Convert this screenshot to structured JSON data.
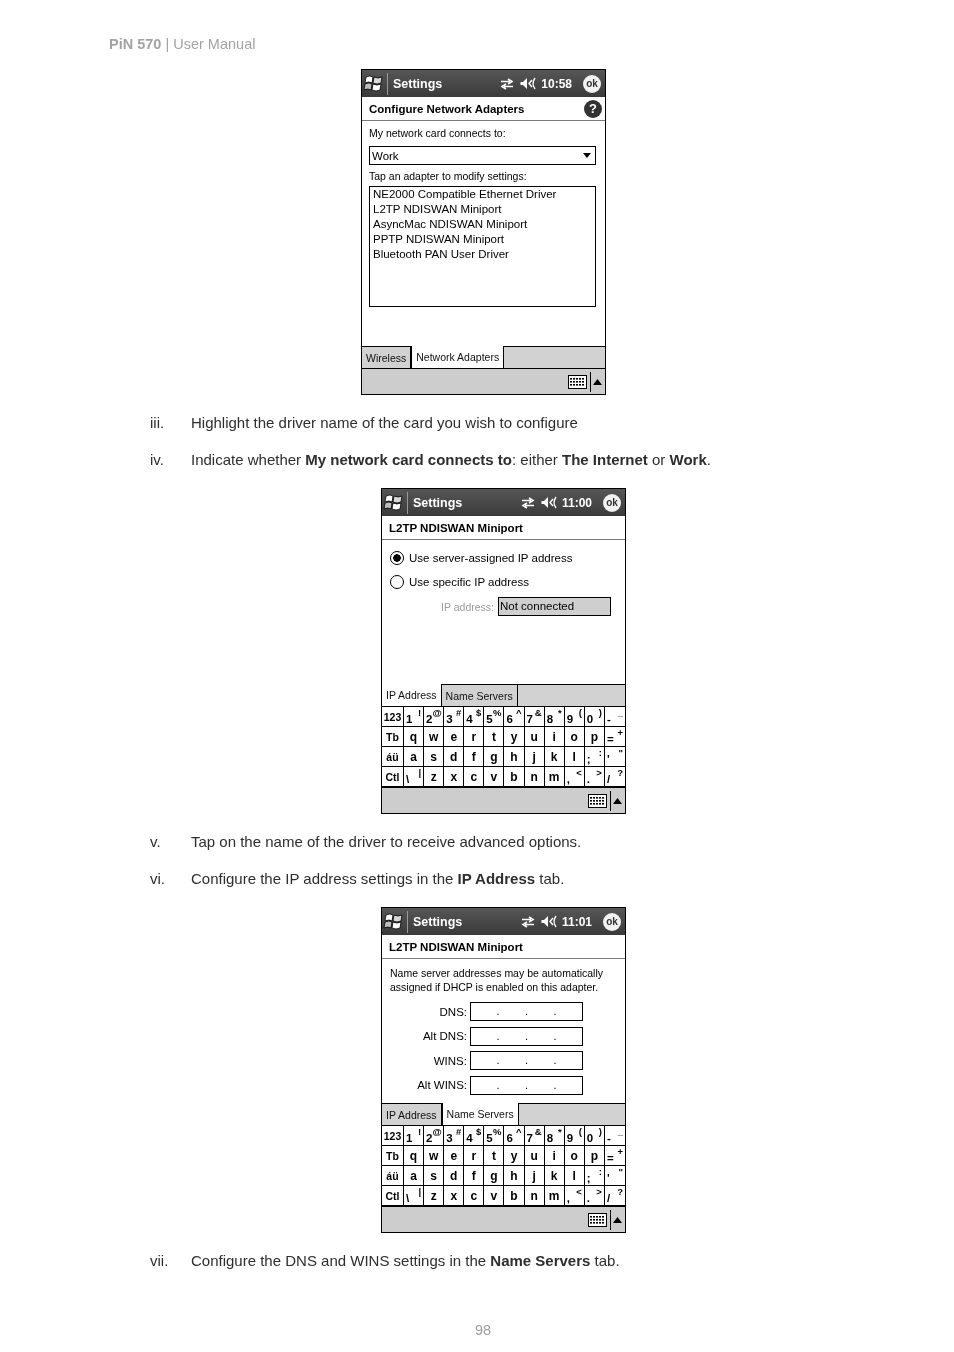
{
  "header": "**PiN 570** | User Manual",
  "content": [
    {
      "kind": "screen",
      "title_bar": {
        "title": "Settings",
        "time": "10:58",
        "ok": "ok"
      },
      "heading": {
        "title": "Configure Network Adapters",
        "help": "?"
      },
      "body": [
        {
          "kind": "label",
          "text": "My network card connects to:"
        },
        {
          "kind": "dropdown",
          "value": "Work"
        },
        {
          "kind": "label",
          "text": "Tap an adapter to modify settings:"
        },
        {
          "kind": "list",
          "items": [
            {
              "label": "NE2000 Compatible Ethernet Driver",
              "selected": false
            },
            {
              "label": "L2TP NDISWAN Miniport",
              "selected": false
            },
            {
              "label": "AsyncMac NDISWAN Miniport",
              "selected": false
            },
            {
              "label": "PPTP NDISWAN Miniport",
              "selected": false
            },
            {
              "label": "Bluetooth PAN User Driver",
              "selected": false
            }
          ]
        }
      ],
      "tabs": [
        {
          "label": "Wireless",
          "selected": false
        },
        {
          "label": "Network Adapters",
          "selected": true
        }
      ]
    },
    {
      "kind": "step",
      "numeral": "iii.",
      "text": "Highlight the driver name of the card you wish to configure"
    },
    {
      "kind": "step",
      "numeral": "iv.",
      "text": "Indicate whether **My network card connects to**: either **The Internet** or **Work**."
    },
    {
      "kind": "screen",
      "title_bar": {
        "title": "Settings",
        "time": "11:00",
        "ok": "ok"
      },
      "heading": {
        "title": "L2TP NDISWAN Miniport"
      },
      "body": [
        {
          "kind": "radio",
          "label": "Use server-assigned IP address",
          "selected": true
        },
        {
          "kind": "radio",
          "label": "Use specific IP address",
          "selected": false
        },
        {
          "kind": "ip_field",
          "label": "IP address:",
          "value": "Not connected",
          "disabled": true
        }
      ],
      "tabs": [
        {
          "label": "IP Address",
          "selected": true
        },
        {
          "label": "Name Servers",
          "selected": false
        }
      ],
      "keyboard": [
        [
          {
            "kind": "function",
            "label": "123"
          },
          {
            "kind": "dual",
            "label": "1",
            "shift": "!"
          },
          {
            "kind": "dual",
            "label": "2",
            "shift": "@"
          },
          {
            "kind": "dual",
            "label": "3",
            "shift": "#"
          },
          {
            "kind": "dual",
            "label": "4",
            "shift": "$"
          },
          {
            "kind": "dual",
            "label": "5",
            "shift": "%"
          },
          {
            "kind": "dual",
            "label": "6",
            "shift": "^"
          },
          {
            "kind": "dual",
            "label": "7",
            "shift": "&"
          },
          {
            "kind": "dual",
            "label": "8",
            "shift": "*"
          },
          {
            "kind": "dual",
            "label": "9",
            "shift": "("
          },
          {
            "kind": "dual",
            "label": "0",
            "shift": ")"
          },
          {
            "kind": "dual",
            "label": "-",
            "shift": "_"
          }
        ],
        [
          {
            "kind": "function",
            "label": "Tb"
          },
          {
            "kind": "letter",
            "label": "q"
          },
          {
            "kind": "letter",
            "label": "w"
          },
          {
            "kind": "letter",
            "label": "e"
          },
          {
            "kind": "letter",
            "label": "r"
          },
          {
            "kind": "letter",
            "label": "t"
          },
          {
            "kind": "letter",
            "label": "y"
          },
          {
            "kind": "letter",
            "label": "u"
          },
          {
            "kind": "letter",
            "label": "i"
          },
          {
            "kind": "letter",
            "label": "o"
          },
          {
            "kind": "letter",
            "label": "p"
          },
          {
            "kind": "dual",
            "label": "=",
            "shift": "+"
          }
        ],
        [
          {
            "kind": "function",
            "label": "áü"
          },
          {
            "kind": "letter",
            "label": "a"
          },
          {
            "kind": "letter",
            "label": "s"
          },
          {
            "kind": "letter",
            "label": "d"
          },
          {
            "kind": "letter",
            "label": "f"
          },
          {
            "kind": "letter",
            "label": "g"
          },
          {
            "kind": "letter",
            "label": "h"
          },
          {
            "kind": "letter",
            "label": "j"
          },
          {
            "kind": "letter",
            "label": "k"
          },
          {
            "kind": "letter",
            "label": "l"
          },
          {
            "kind": "dual",
            "label": ";",
            "shift": ":"
          },
          {
            "kind": "dual",
            "label": "'",
            "shift": "\""
          }
        ],
        [
          {
            "kind": "function",
            "label": "Ctl"
          },
          {
            "kind": "dual",
            "label": "\\",
            "shift": "|"
          },
          {
            "kind": "letter",
            "label": "z"
          },
          {
            "kind": "letter",
            "label": "x"
          },
          {
            "kind": "letter",
            "label": "c"
          },
          {
            "kind": "letter",
            "label": "v"
          },
          {
            "kind": "letter",
            "label": "b"
          },
          {
            "kind": "letter",
            "label": "n"
          },
          {
            "kind": "letter",
            "label": "m"
          },
          {
            "kind": "dual",
            "label": ",",
            "shift": "<"
          },
          {
            "kind": "dual",
            "label": ".",
            "shift": ">"
          },
          {
            "kind": "dual",
            "label": "/",
            "shift": "?"
          }
        ]
      ]
    },
    {
      "kind": "step",
      "numeral": "v.",
      "text": "Tap on the name of the driver to receive advanced options."
    },
    {
      "kind": "step",
      "numeral": "vi.",
      "text": "Configure the IP address settings in the **IP Address** tab."
    },
    {
      "kind": "screen",
      "title_bar": {
        "title": "Settings",
        "time": "11:01",
        "ok": "ok"
      },
      "heading": {
        "title": "L2TP NDISWAN Miniport"
      },
      "body": [
        {
          "kind": "paragraph",
          "text": "Name server addresses may be automatically assigned if DHCP is enabled on this adapter."
        },
        {
          "kind": "address_field",
          "label": "DNS:",
          "separators": [
            ".",
            ".",
            "."
          ]
        },
        {
          "kind": "address_field",
          "label": "Alt DNS:",
          "separators": [
            ".",
            ".",
            "."
          ]
        },
        {
          "kind": "address_field",
          "label": "WINS:",
          "separators": [
            ".",
            ".",
            "."
          ]
        },
        {
          "kind": "address_field",
          "label": "Alt WINS:",
          "separators": [
            ".",
            ".",
            "."
          ]
        }
      ],
      "tabs": [
        {
          "label": "IP Address",
          "selected": false
        },
        {
          "label": "Name Servers",
          "selected": true
        }
      ],
      "keyboard": [
        [
          {
            "kind": "function",
            "label": "123"
          },
          {
            "kind": "dual",
            "label": "1",
            "shift": "!"
          },
          {
            "kind": "dual",
            "label": "2",
            "shift": "@"
          },
          {
            "kind": "dual",
            "label": "3",
            "shift": "#"
          },
          {
            "kind": "dual",
            "label": "4",
            "shift": "$"
          },
          {
            "kind": "dual",
            "label": "5",
            "shift": "%"
          },
          {
            "kind": "dual",
            "label": "6",
            "shift": "^"
          },
          {
            "kind": "dual",
            "label": "7",
            "shift": "&"
          },
          {
            "kind": "dual",
            "label": "8",
            "shift": "*"
          },
          {
            "kind": "dual",
            "label": "9",
            "shift": "("
          },
          {
            "kind": "dual",
            "label": "0",
            "shift": ")"
          },
          {
            "kind": "dual",
            "label": "-",
            "shift": "_"
          }
        ],
        [
          {
            "kind": "function",
            "label": "Tb"
          },
          {
            "kind": "letter",
            "label": "q"
          },
          {
            "kind": "letter",
            "label": "w"
          },
          {
            "kind": "letter",
            "label": "e"
          },
          {
            "kind": "letter",
            "label": "r"
          },
          {
            "kind": "letter",
            "label": "t"
          },
          {
            "kind": "letter",
            "label": "y"
          },
          {
            "kind": "letter",
            "label": "u"
          },
          {
            "kind": "letter",
            "label": "i"
          },
          {
            "kind": "letter",
            "label": "o"
          },
          {
            "kind": "letter",
            "label": "p"
          },
          {
            "kind": "dual",
            "label": "=",
            "shift": "+"
          }
        ],
        [
          {
            "kind": "function",
            "label": "áü"
          },
          {
            "kind": "letter",
            "label": "a"
          },
          {
            "kind": "letter",
            "label": "s"
          },
          {
            "kind": "letter",
            "label": "d"
          },
          {
            "kind": "letter",
            "label": "f"
          },
          {
            "kind": "letter",
            "label": "g"
          },
          {
            "kind": "letter",
            "label": "h"
          },
          {
            "kind": "letter",
            "label": "j"
          },
          {
            "kind": "letter",
            "label": "k"
          },
          {
            "kind": "letter",
            "label": "l"
          },
          {
            "kind": "dual",
            "label": ";",
            "shift": ":"
          },
          {
            "kind": "dual",
            "label": "'",
            "shift": "\""
          }
        ],
        [
          {
            "kind": "function",
            "label": "Ctl"
          },
          {
            "kind": "dual",
            "label": "\\",
            "shift": "|"
          },
          {
            "kind": "letter",
            "label": "z"
          },
          {
            "kind": "letter",
            "label": "x"
          },
          {
            "kind": "letter",
            "label": "c"
          },
          {
            "kind": "letter",
            "label": "v"
          },
          {
            "kind": "letter",
            "label": "b"
          },
          {
            "kind": "letter",
            "label": "n"
          },
          {
            "kind": "letter",
            "label": "m"
          },
          {
            "kind": "dual",
            "label": ",",
            "shift": "<"
          },
          {
            "kind": "dual",
            "label": ".",
            "shift": ">"
          },
          {
            "kind": "dual",
            "label": "/",
            "shift": "?"
          }
        ]
      ]
    },
    {
      "kind": "step",
      "numeral": "vii.",
      "text": "Configure the DNS and WINS settings in the **Name Servers** tab."
    }
  ],
  "page_number": "98"
}
